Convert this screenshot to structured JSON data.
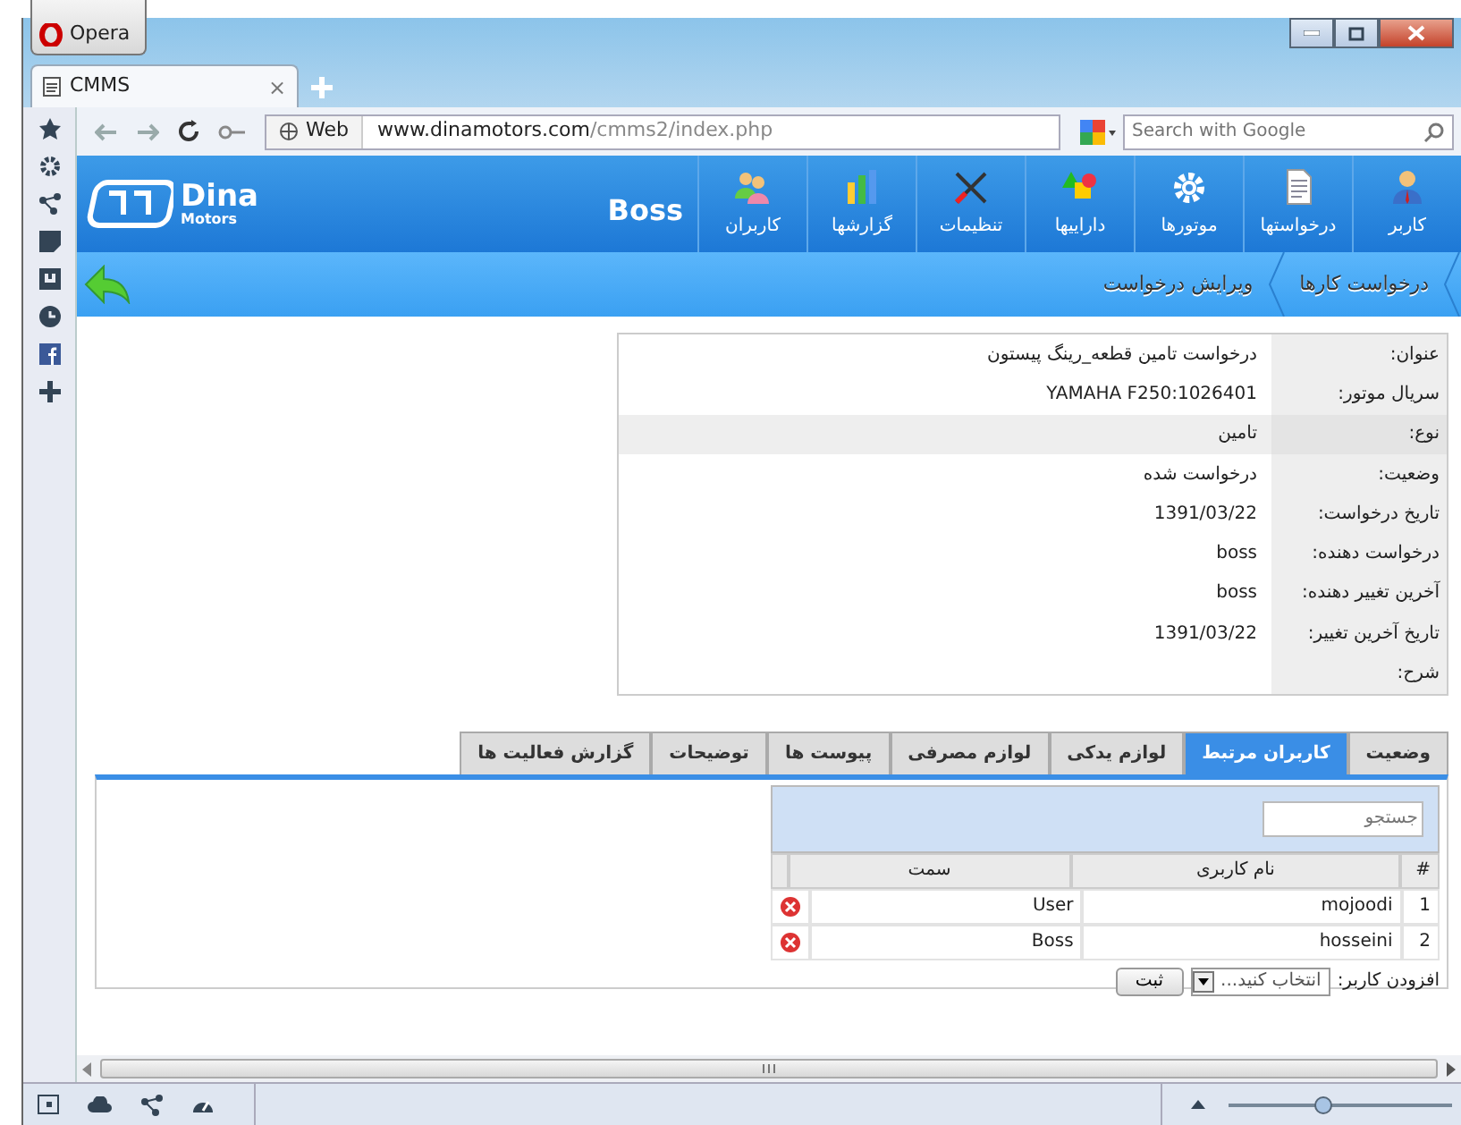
{
  "browser": {
    "app_button": "Opera",
    "tab_title": "CMMS",
    "tab_close": "×",
    "address_scheme": "Web",
    "url_host": "www.dinamotors.com",
    "url_path": "/cmms2/index.php",
    "search_placeholder": "Search with Google"
  },
  "header": {
    "logo_title": "Dina",
    "logo_subtitle": "Motors",
    "user": "Boss",
    "nav": [
      {
        "label": "کاربر"
      },
      {
        "label": "درخواستها"
      },
      {
        "label": "موتورها"
      },
      {
        "label": "داراییها"
      },
      {
        "label": "تنظیمات"
      },
      {
        "label": "گزارشها"
      },
      {
        "label": "کاربران"
      }
    ]
  },
  "breadcrumb": [
    "درخواست کارها",
    "ویرایش درخواست"
  ],
  "details": [
    {
      "label": "عنوان:",
      "value": "درخواست تامین قطعه_رینگ پیستون",
      "highlighted": false
    },
    {
      "label": "سریال موتور:",
      "value": "YAMAHA F250:1026401",
      "highlighted": false
    },
    {
      "label": "نوع:",
      "value": "تامین",
      "highlighted": true
    },
    {
      "label": "وضعیت:",
      "value": "درخواست شده",
      "highlighted": false
    },
    {
      "label": "تاریخ درخواست:",
      "value": "1391/03/22",
      "highlighted": false
    },
    {
      "label": "درخواست دهنده:",
      "value": "boss",
      "highlighted": false
    },
    {
      "label": "آخرین تغییر دهنده:",
      "value": "boss",
      "highlighted": false
    },
    {
      "label": "تاریخ آخرین تغییر:",
      "value": "1391/03/22",
      "highlighted": false
    },
    {
      "label": "شرح:",
      "highlighted": false
    }
  ],
  "tabs": [
    {
      "label": "وضعیت",
      "selected": false
    },
    {
      "label": "کاربران مرتبط",
      "selected": true
    },
    {
      "label": "لوازم یدکی",
      "selected": false
    },
    {
      "label": "لوازم مصرفی",
      "selected": false
    },
    {
      "label": "پیوست ها",
      "selected": false
    },
    {
      "label": "توضیحات",
      "selected": false
    },
    {
      "label": "گزارش فعالیت ها",
      "selected": false
    }
  ],
  "users": {
    "search_placeholder": "جستجو",
    "columns": [
      "#",
      "نام کاربری",
      "سمت"
    ],
    "rows": [
      {
        "number": "1",
        "username": "mojoodi",
        "role": "User"
      },
      {
        "number": "2",
        "username": "hosseini",
        "role": "Boss"
      }
    ],
    "add_label": "افزودن کاربر:",
    "add_select": "انتخاب کنید...",
    "add_button": "ثبت"
  },
  "status_bar": {
    "zoom_slider": {
      "level": 0.42
    }
  }
}
